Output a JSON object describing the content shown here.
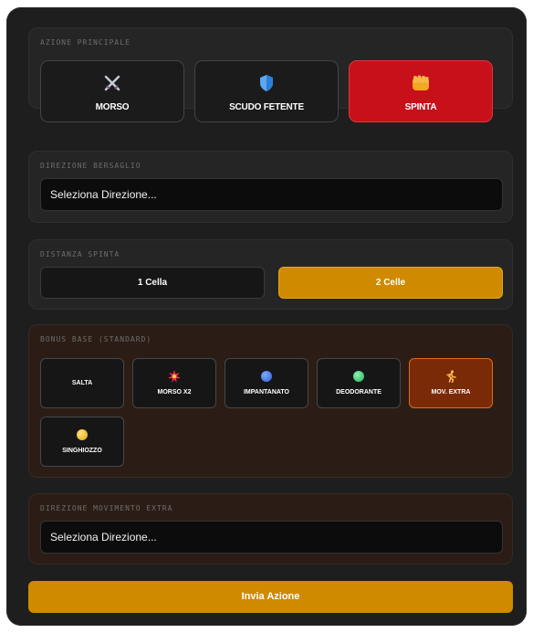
{
  "main_action": {
    "title": "AZIONE PRINCIPALE",
    "buttons": [
      {
        "label": "MORSO",
        "icon": "crossed-swords-icon"
      },
      {
        "label": "SCUDO FETENTE",
        "icon": "shield-icon"
      },
      {
        "label": "SPINTA",
        "icon": "fist-icon"
      }
    ],
    "selected": "SPINTA"
  },
  "target_direction": {
    "title": "DIREZIONE BERSAGLIO",
    "value": "Seleziona Direzione..."
  },
  "push_distance": {
    "title": "DISTANZA SPINTA",
    "options": [
      "1 Cella",
      "2 Celle"
    ],
    "selected": "2 Celle"
  },
  "base_bonus": {
    "title": "BONUS BASE (STANDARD)",
    "options": [
      {
        "label": "SALTA",
        "icon": ""
      },
      {
        "label": "MORSO X2",
        "icon": "explosion-icon"
      },
      {
        "label": "IMPANTANATO",
        "icon": "blue-dot-icon"
      },
      {
        "label": "DEODORANTE",
        "icon": "green-dot-icon"
      },
      {
        "label": "MOV. EXTRA",
        "icon": "runner-icon"
      },
      {
        "label": "SINGHIOZZO",
        "icon": "yellow-dot-icon"
      }
    ],
    "selected": "MOV. EXTRA"
  },
  "extra_move_direction": {
    "title": "DIREZIONE MOVIMENTO EXTRA",
    "value": "Seleziona Direzione..."
  },
  "submit_label": "Invia Azione",
  "colors": {
    "accent_red": "#c8101a",
    "accent_amber": "#cf8a00",
    "accent_orange": "#e06c14"
  }
}
